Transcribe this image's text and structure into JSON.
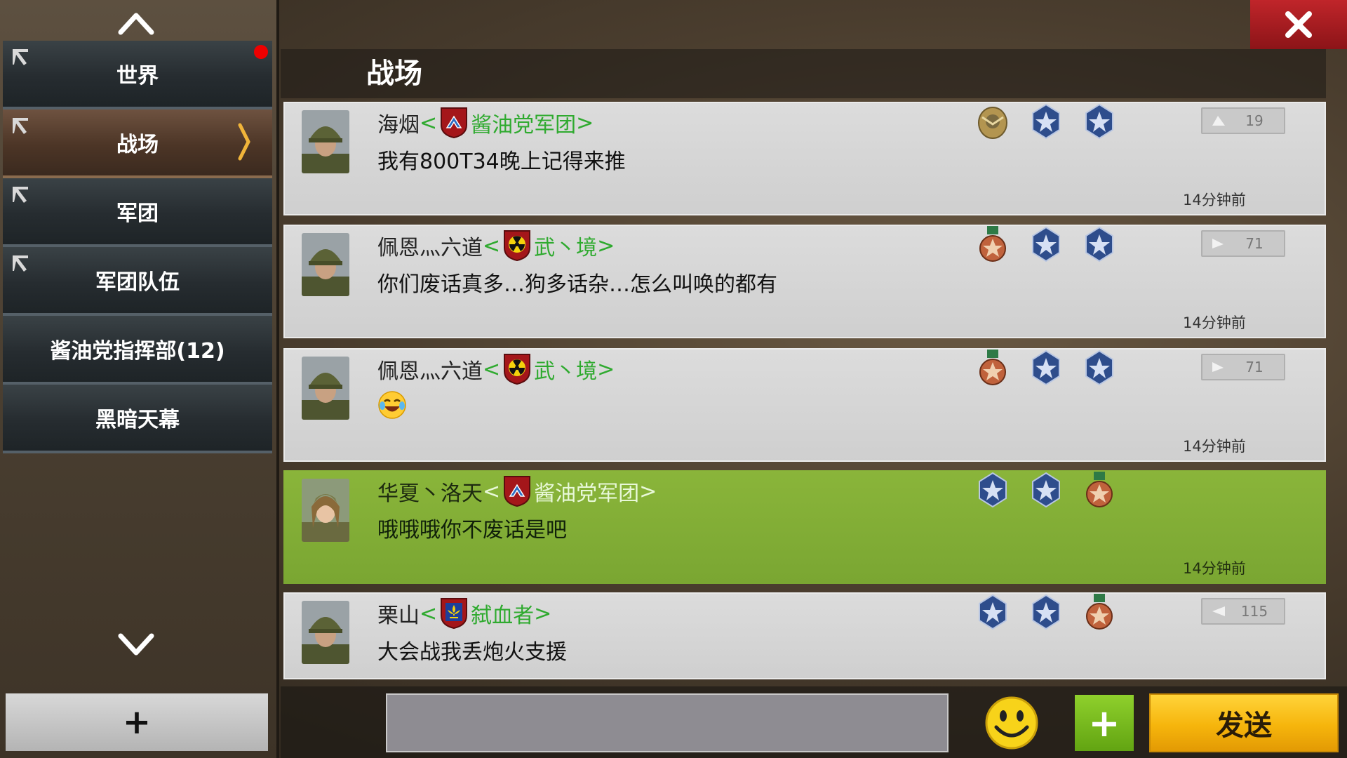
{
  "sidebar": {
    "items": [
      {
        "label": "世界",
        "pinned": true,
        "active": false,
        "unread": true
      },
      {
        "label": "战场",
        "pinned": true,
        "active": true,
        "unread": false
      },
      {
        "label": "军团",
        "pinned": true,
        "active": false,
        "unread": false
      },
      {
        "label": "军团队伍",
        "pinned": true,
        "active": false,
        "unread": false
      },
      {
        "label": "酱油党指挥部(12)",
        "pinned": false,
        "active": false,
        "unread": false
      },
      {
        "label": "黑暗天幕",
        "pinned": false,
        "active": false,
        "unread": false
      }
    ],
    "add_label": "+"
  },
  "header": {
    "title": "战场",
    "close_icon": "close-icon"
  },
  "messages": [
    {
      "name": "海烟",
      "bracket_open": "<",
      "guild": "酱油党军团",
      "bracket_close": ">",
      "emblem": "chevron-shield-emblem",
      "text": "我有800T34晚上记得来推",
      "medals": [
        "eagle-medal",
        "star-badge-medal",
        "star-badge-medal"
      ],
      "rank": "19",
      "time": "14分钟前",
      "own": false,
      "avatar": "soldier-avatar"
    },
    {
      "name": "佩恩灬六道",
      "bracket_open": "<",
      "guild": "武丶境",
      "bracket_close": ">",
      "emblem": "radiation-shield-emblem",
      "text": "你们废话真多…狗多话杂…怎么叫唤的都有",
      "medals": [
        "bronze-star-medal",
        "star-badge-medal",
        "star-badge-medal"
      ],
      "rank": "71",
      "time": "14分钟前",
      "own": false,
      "avatar": "soldier-avatar"
    },
    {
      "name": "佩恩灬六道",
      "bracket_open": "<",
      "guild": "武丶境",
      "bracket_close": ">",
      "emblem": "radiation-shield-emblem",
      "text": "",
      "emoji": "laughing-tears-emoji",
      "medals": [
        "bronze-star-medal",
        "star-badge-medal",
        "star-badge-medal"
      ],
      "rank": "71",
      "time": "14分钟前",
      "own": false,
      "avatar": "soldier-avatar"
    },
    {
      "name": "华夏丶洛天",
      "bracket_open": "<",
      "guild": "酱油党军团",
      "bracket_close": ">",
      "emblem": "chevron-shield-emblem",
      "text": "哦哦哦你不废话是吧",
      "medals": [
        "star-badge-medal",
        "star-badge-medal",
        "bronze-star-medal"
      ],
      "rank": "",
      "time": "14分钟前",
      "own": true,
      "avatar": "officer-avatar"
    },
    {
      "name": "栗山",
      "bracket_open": "<",
      "guild": "弑血者",
      "bracket_close": ">",
      "emblem": "fleur-shield-emblem",
      "text": "大会战我丢炮火支援",
      "medals": [
        "star-badge-medal",
        "star-badge-medal",
        "bronze-star-medal"
      ],
      "rank": "115",
      "time": "",
      "own": false,
      "avatar": "soldier-avatar"
    }
  ],
  "input": {
    "value": "",
    "placeholder": ""
  },
  "bottom": {
    "plus_label": "+",
    "send_label": "发送"
  },
  "colors": {
    "guild_text": "#2faa2f",
    "own_message_bg": "#7aa632",
    "send_button": "#f6b50c",
    "close_button": "#b11e22",
    "active_tab": "#5a3f2e"
  }
}
